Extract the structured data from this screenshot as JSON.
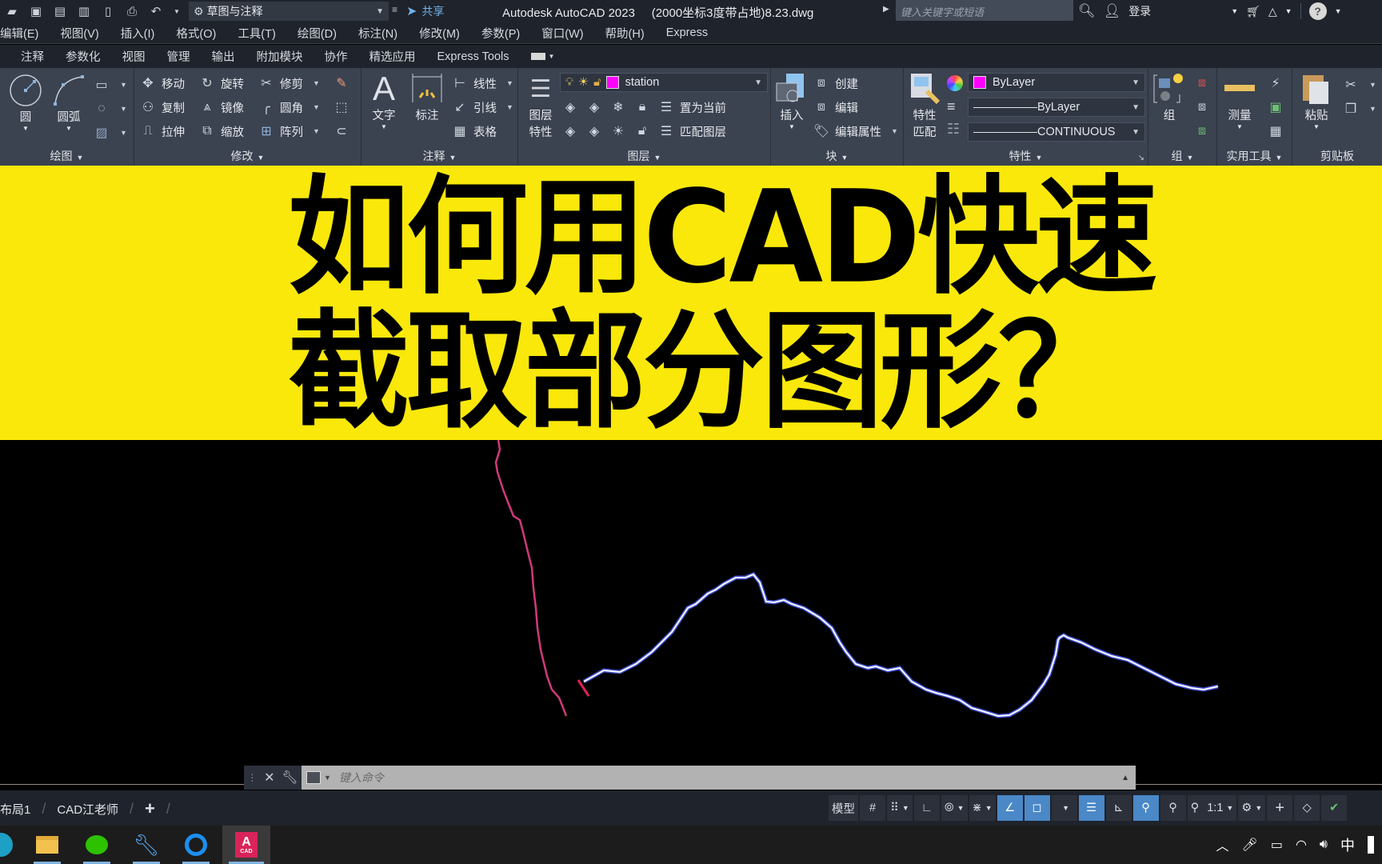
{
  "titlebar": {
    "quick_access": [
      "open-icon",
      "save-icon",
      "save-as-icon",
      "publish-icon",
      "share-drawing-icon",
      "plot-icon",
      "undo-icon",
      "redo-icon"
    ],
    "workspace": "草图与注释",
    "share_label": "共享",
    "app_title": "Autodesk AutoCAD 2023",
    "file_name": "(2000坐标3度带占地)8.23.dwg",
    "search_placeholder": "键入关键字或短语",
    "signin_label": "登录"
  },
  "menubar": {
    "items": [
      "编辑(E)",
      "视图(V)",
      "插入(I)",
      "格式(O)",
      "工具(T)",
      "绘图(D)",
      "标注(N)",
      "修改(M)",
      "参数(P)",
      "窗口(W)",
      "帮助(H)",
      "Express"
    ]
  },
  "ribbon_tabs": {
    "items": [
      "注释",
      "参数化",
      "视图",
      "管理",
      "输出",
      "附加模块",
      "协作",
      "精选应用",
      "Express Tools"
    ]
  },
  "ribbon": {
    "draw": {
      "label": "绘图",
      "circle": "圆",
      "arc": "圆弧"
    },
    "modify": {
      "label": "修改",
      "move": "移动",
      "rotate": "旋转",
      "trim": "修剪",
      "copy": "复制",
      "mirror": "镜像",
      "fillet": "圆角",
      "stretch": "拉伸",
      "scale": "缩放",
      "array": "阵列"
    },
    "annotation": {
      "label": "注释",
      "text": "文字",
      "dimension": "标注",
      "linear": "线性",
      "leader": "引线",
      "table": "表格"
    },
    "layers": {
      "label": "图层",
      "properties_l1": "图层",
      "properties_l2": "特性",
      "current_layer": "station",
      "make_current": "置为当前",
      "match_layer": "匹配图层",
      "layer_color": "#ff00ff"
    },
    "block": {
      "label": "块",
      "insert": "插入",
      "create": "创建",
      "edit": "编辑",
      "edit_attributes": "编辑属性"
    },
    "properties": {
      "label": "特性",
      "match_l1": "特性",
      "match_l2": "匹配",
      "color": "ByLayer",
      "lineweight": "ByLayer",
      "linetype": "CONTINUOUS",
      "color_swatch": "#ff00ff"
    },
    "groups": {
      "label": "组",
      "group": "组"
    },
    "utilities": {
      "label": "实用工具",
      "measure": "测量"
    },
    "clipboard": {
      "label": "剪贴板",
      "paste": "粘贴"
    }
  },
  "banner": {
    "line1": "如何用CAD快速",
    "line2": "截取部分图形？",
    "background": "#f9e80a"
  },
  "commandline": {
    "placeholder": "键入命令"
  },
  "layout_tabs": {
    "items": [
      "布局1",
      "CAD江老师"
    ],
    "add_label": "+"
  },
  "statusbar": {
    "model_label": "模型",
    "scale_label": "1:1"
  },
  "taskbar": {
    "apps": [
      "edge-icon",
      "file-explorer-icon",
      "wechat-icon",
      "tools-icon",
      "qq-browser-icon",
      "autocad-icon"
    ],
    "autocad_badge": "A",
    "autocad_sub": "CAD",
    "ime": "中"
  }
}
